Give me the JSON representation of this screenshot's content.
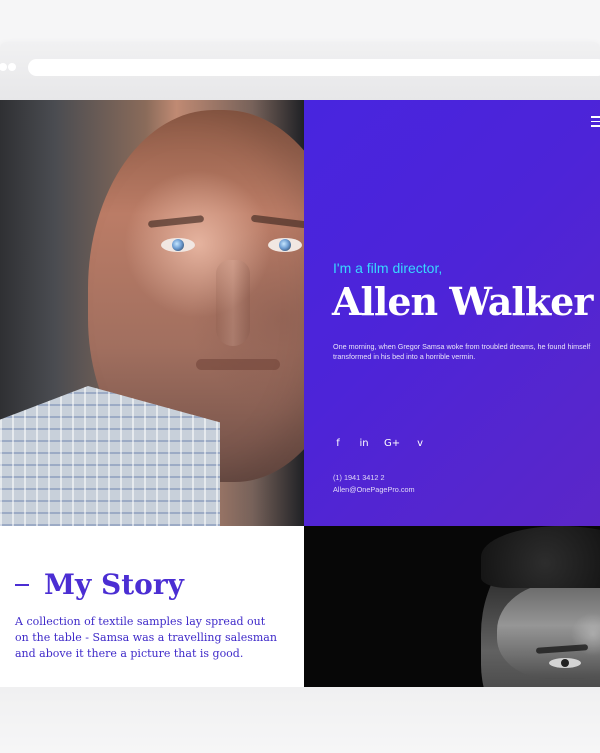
{
  "hero": {
    "intro": "I'm a film director,",
    "name": "Allen Walker",
    "bio": "One morning, when Gregor Samsa woke from troubled dreams, he found himself transformed in his bed into a horrible vermin.",
    "phone": "(1) 1941 3412 2",
    "email": "Allen@OnePagePro.com",
    "social": [
      {
        "label": "f",
        "icon": "facebook-icon"
      },
      {
        "label": "in",
        "icon": "linkedin-icon"
      },
      {
        "label": "G+",
        "icon": "google-plus-icon"
      },
      {
        "label": "v",
        "icon": "vimeo-icon"
      }
    ]
  },
  "story": {
    "title": "My Story",
    "text": "A collection of textile samples lay spread out on the table - Samsa was a travelling salesman and above it there a picture that is good."
  },
  "colors": {
    "accent": "#4b2ed3",
    "hero_intro": "#37d8ff",
    "hero_panel": "#4825df"
  }
}
